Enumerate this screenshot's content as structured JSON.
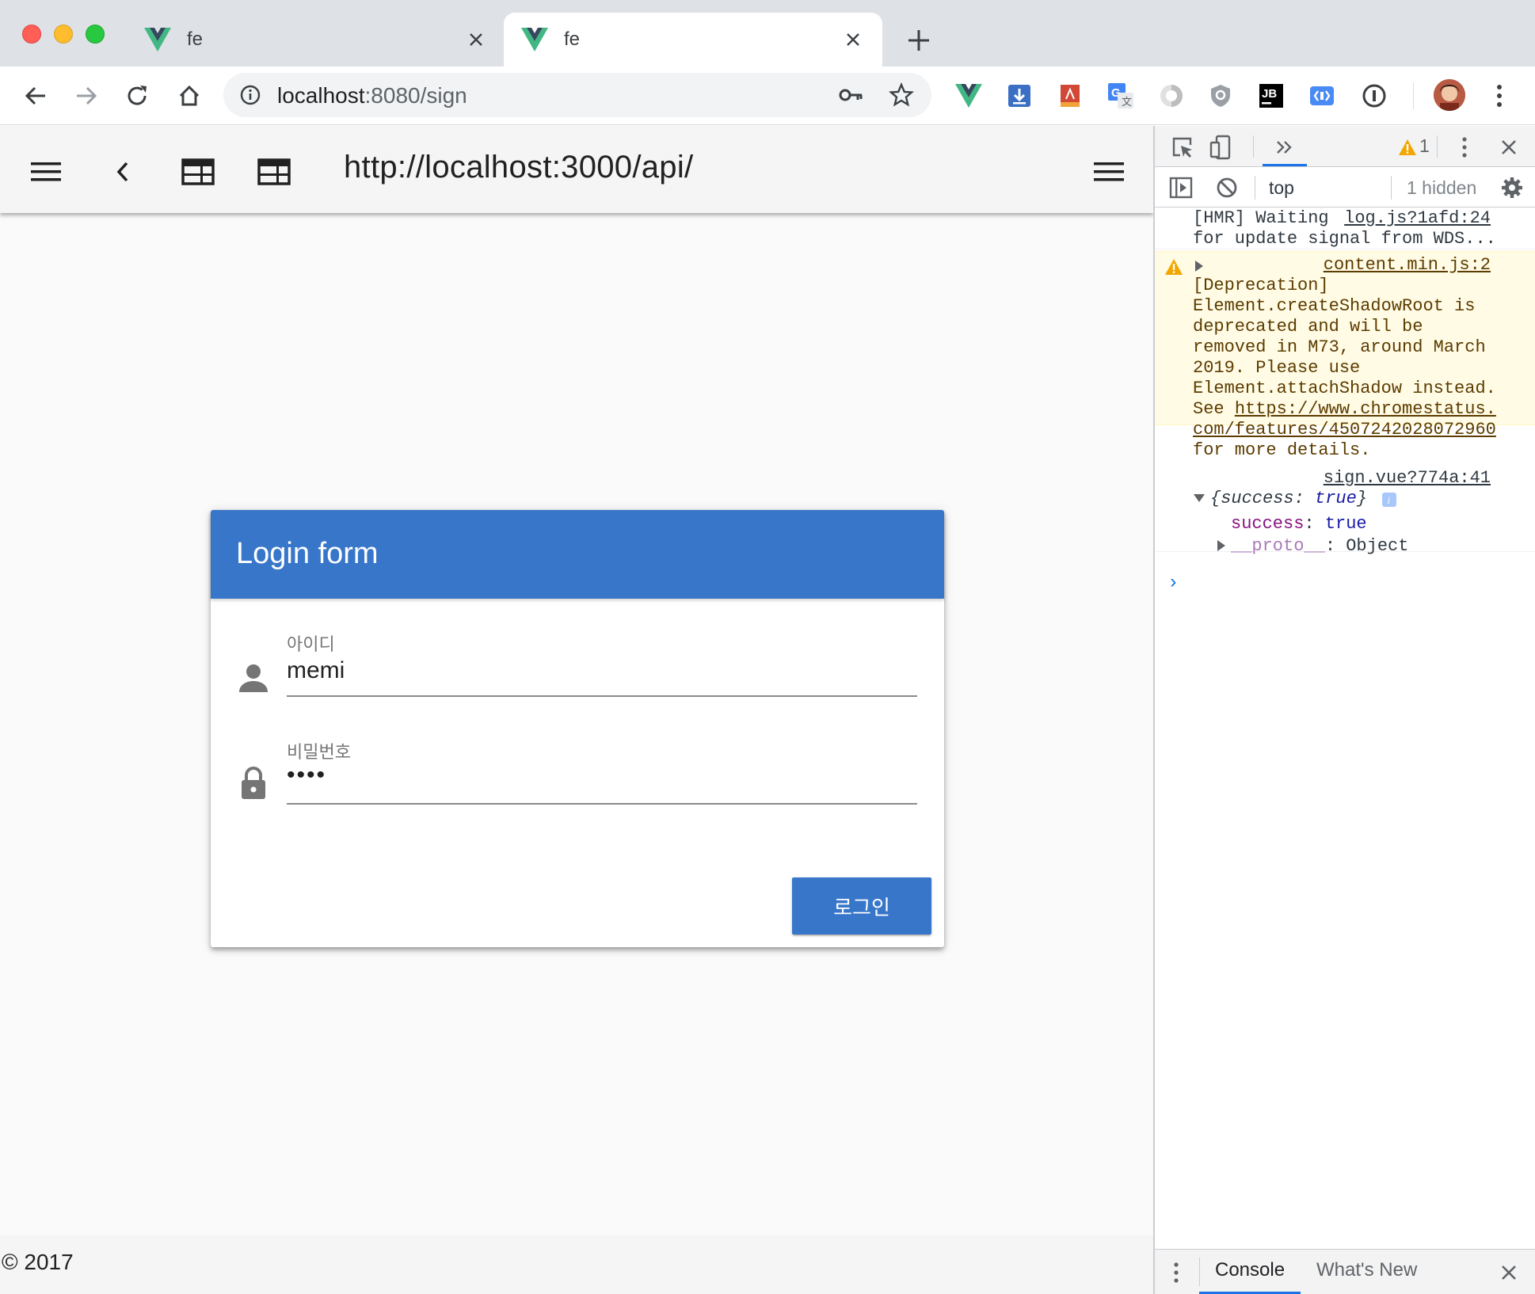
{
  "browser": {
    "tabs": [
      {
        "title": "fe",
        "active": false
      },
      {
        "title": "fe",
        "active": true
      }
    ],
    "address": {
      "host": "localhost",
      "rest": ":8080/sign"
    },
    "extensions": [
      "vue-devtools-icon",
      "download-icon",
      "pdf-icon",
      "translate-icon",
      "half-circle-icon",
      "shield-icon",
      "jetbrains-icon",
      "tag-icon",
      "onepassword-icon"
    ]
  },
  "app": {
    "toolbar_title": "http://localhost:3000/api/",
    "card": {
      "title": "Login form",
      "id_label": "아이디",
      "id_value": "memi",
      "pw_label": "비밀번호",
      "pw_value": "••••",
      "submit_label": "로그인"
    },
    "footer": "© 2017"
  },
  "devtools": {
    "warning_count": "1",
    "context": "top",
    "hidden": "1 hidden",
    "messages": {
      "hmr": {
        "src": "log.js?1afd:24",
        "line1": "[HMR] Waiting",
        "line2": "for update signal from WDS..."
      },
      "deprecation": {
        "src": "content.min.js:2",
        "lines": [
          "[Deprecation]",
          "Element.createShadowRoot is",
          "deprecated and will be",
          "removed in M73, around March",
          "2019. Please use",
          "Element.attachShadow instead."
        ],
        "see": "See ",
        "link1": "https://www.chromestatus.",
        "link2": "com/features/4507242028072960",
        "tail": "for more details."
      },
      "log": {
        "src": "sign.vue?774a:41",
        "summary_open": "{",
        "summary_key": "success",
        "summary_sep": ": ",
        "summary_val": "true",
        "summary_close": "}",
        "prop_key": "success",
        "prop_val": "true",
        "proto_key": "__proto__",
        "proto_val": ": Object"
      }
    },
    "drawer": {
      "console": "Console",
      "whats_new": "What's New"
    }
  }
}
